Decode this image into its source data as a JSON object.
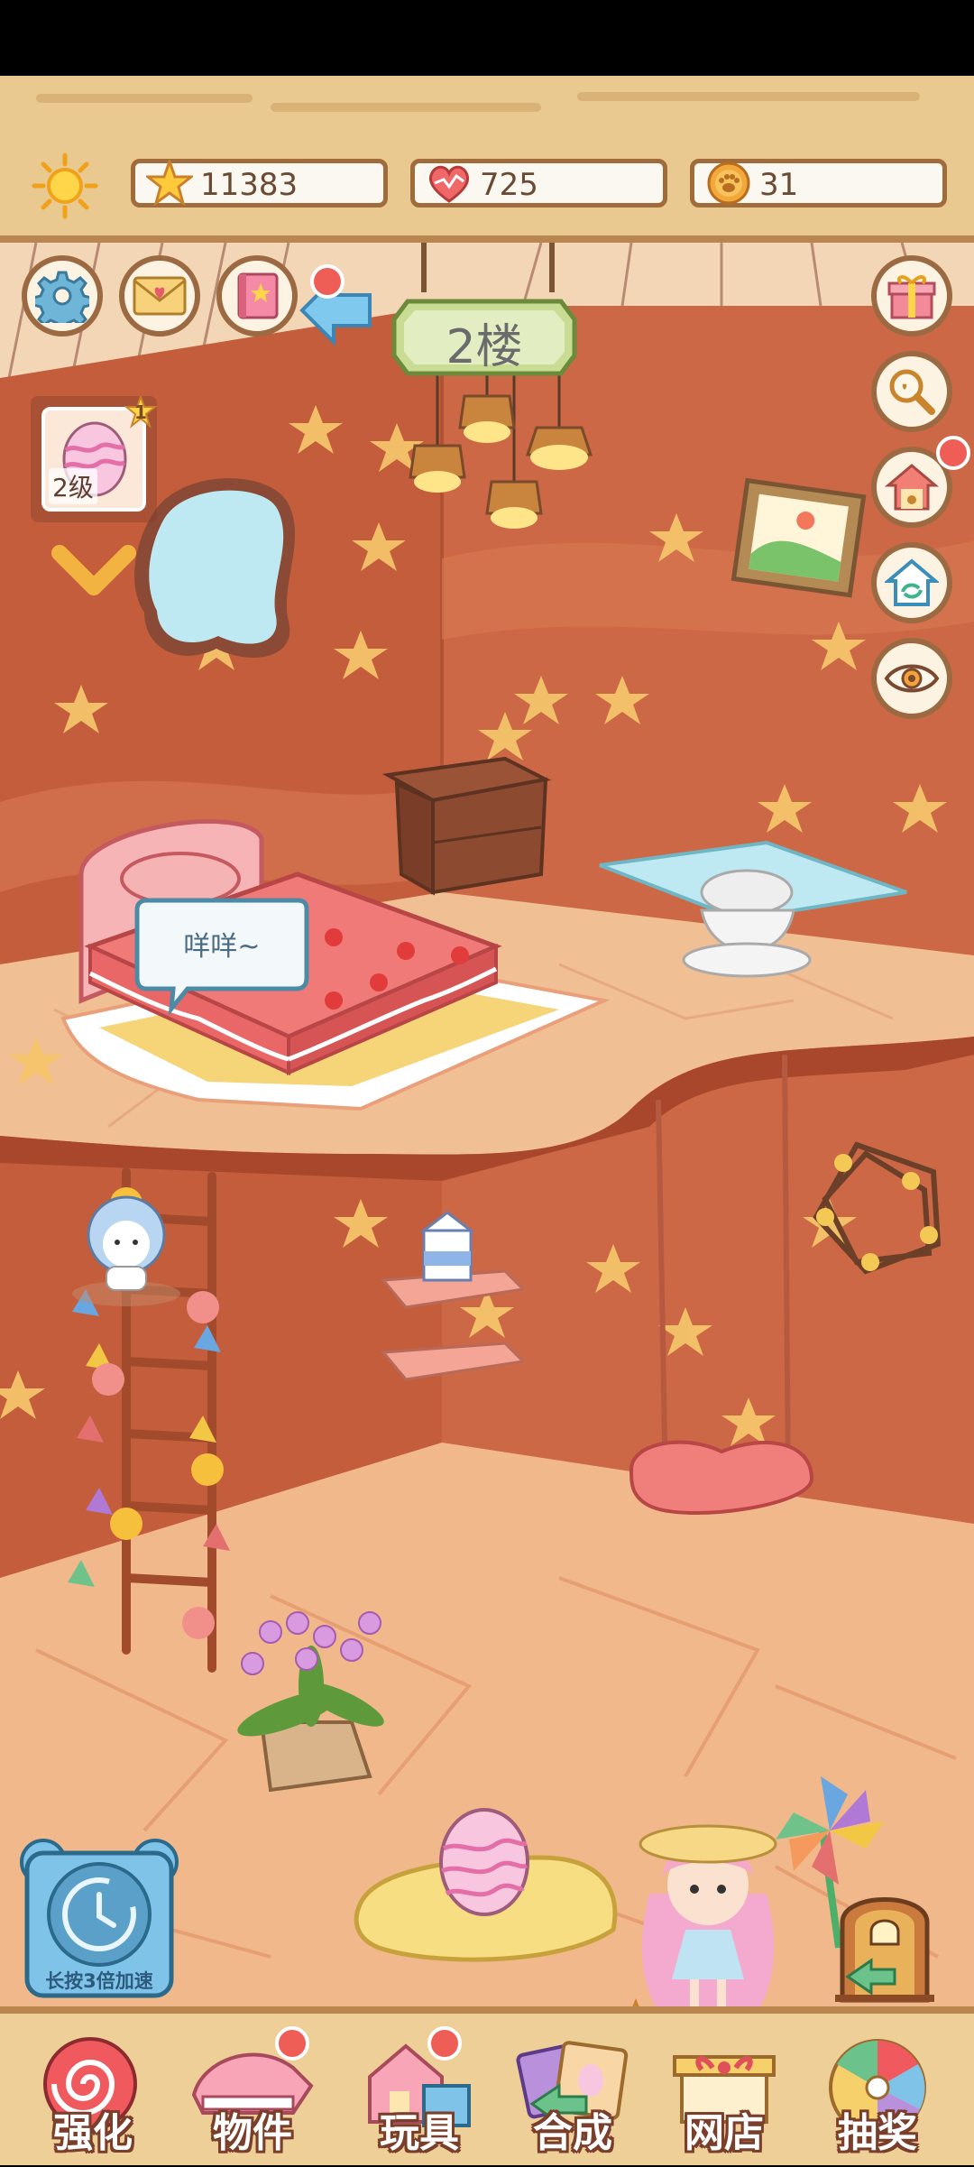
{
  "resources": {
    "stars": "11383",
    "hearts": "725",
    "paws": "31"
  },
  "floor_sign": "2楼",
  "egg_level": {
    "badge": "1",
    "label": "2级"
  },
  "speech_bubble": "咩咩~",
  "speed_button_label": "长按3倍加速",
  "nav": {
    "enhance": "强化",
    "items": "物件",
    "toys": "玩具",
    "merge": "合成",
    "shop": "网店",
    "lottery": "抽奖"
  },
  "colors": {
    "wall": "#c95f3f",
    "floor": "#f1b98b",
    "wood": "#e9c98f",
    "leaf": "#f4c46a"
  },
  "icons": {
    "weather": "sun-icon",
    "settings": "gear-icon",
    "mail": "letter-icon",
    "album": "book-icon",
    "back": "arrow-icon",
    "gift": "gift-icon",
    "search": "magnifier-icon",
    "home": "house-icon",
    "recycle": "recycle-house-icon",
    "view": "eye-icon",
    "exit": "door-icon"
  }
}
